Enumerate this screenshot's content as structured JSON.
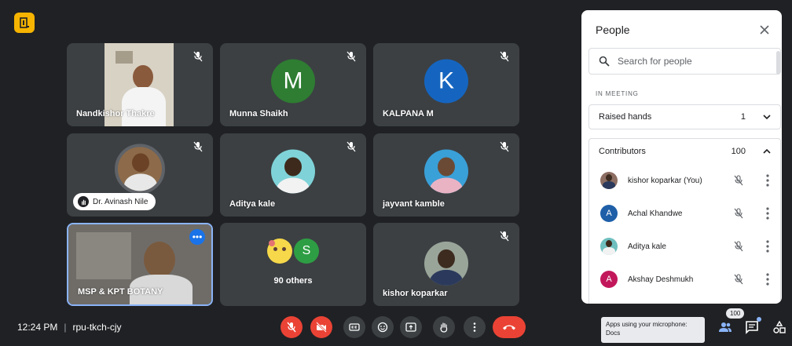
{
  "tiles": {
    "t1": {
      "name": "Nandkishor Thakre"
    },
    "t2": {
      "name": "Munna Shaikh",
      "initial": "M",
      "color": "#2e7d32"
    },
    "t3": {
      "name": "KALPANA M",
      "initial": "K",
      "color": "#1565c0"
    },
    "t4": {
      "name": "Dr. Avinash Nile"
    },
    "t5": {
      "name": "Aditya kale"
    },
    "t6": {
      "name": "jayvant kamble"
    },
    "t7": {
      "name": "MSP & KPT BOTANY",
      "more": "•••"
    },
    "t8": {
      "name": "90 others",
      "initial": "S",
      "color": "#2e9e44"
    },
    "t9": {
      "name": "kishor koparkar"
    }
  },
  "panel": {
    "title": "People",
    "search_placeholder": "Search for people",
    "section": "IN MEETING",
    "raised": {
      "label": "Raised hands",
      "count": "1"
    },
    "contributors": {
      "label": "Contributors",
      "count": "100"
    },
    "people": [
      {
        "name": "kishor koparkar (You)",
        "initial": "",
        "color": "#8d6e63"
      },
      {
        "name": "Achal Khandwe",
        "initial": "A",
        "color": "#1e5fa8"
      },
      {
        "name": "Aditya kale",
        "initial": "",
        "color": "#6fbfbf"
      },
      {
        "name": "Akshay Deshmukh",
        "initial": "A",
        "color": "#c2185b"
      }
    ]
  },
  "bottom": {
    "time": "12:24 PM",
    "separator": "|",
    "code": "rpu-tkch-cjy",
    "tooltip": "Apps using your microphone: Docs",
    "people_count": "100"
  }
}
